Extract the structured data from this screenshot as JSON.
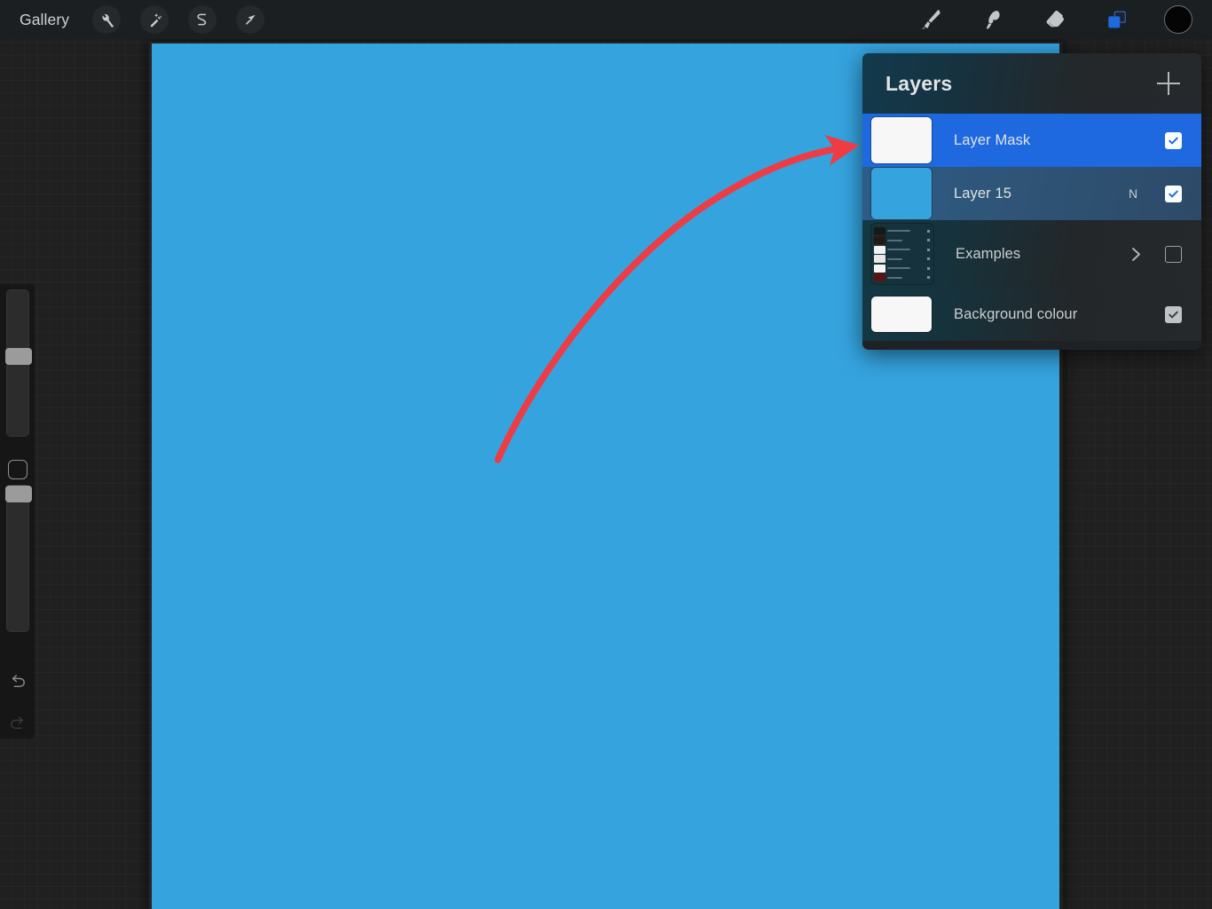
{
  "app": {
    "name": "Procreate",
    "canvas_color": "#35a3de",
    "accent_color": "#1f69e0",
    "annotation_color": "#ef3b44"
  },
  "topbar": {
    "gallery_label": "Gallery",
    "left_tools": [
      {
        "name": "actions-wrench-icon",
        "label": "Actions"
      },
      {
        "name": "adjustments-magic-icon",
        "label": "Adjustments"
      },
      {
        "name": "selection-icon",
        "label": "Selection"
      },
      {
        "name": "transform-arrow-icon",
        "label": "Transform"
      }
    ],
    "right_tools": [
      {
        "name": "paint-brush-icon",
        "label": "Paint"
      },
      {
        "name": "smudge-icon",
        "label": "Smudge"
      },
      {
        "name": "eraser-icon",
        "label": "Erase"
      },
      {
        "name": "layers-icon",
        "label": "Layers",
        "active": true
      }
    ],
    "color_swatch": {
      "name": "color-swatch",
      "label": "Colour",
      "value": "#050505"
    }
  },
  "sidebar": {
    "brush_size": {
      "label": "Brush size",
      "value_percent": 56
    },
    "modify_button": {
      "label": "Modify"
    },
    "opacity": {
      "label": "Opacity",
      "value_percent": 100
    },
    "undo": {
      "label": "Undo"
    },
    "redo": {
      "label": "Redo"
    }
  },
  "layers_panel": {
    "title": "Layers",
    "add_button_label": "Add layer",
    "rows": [
      {
        "name": "Layer Mask",
        "thumb": "white",
        "selected": "primary",
        "blend": "",
        "visible": true,
        "checkbox": "on",
        "chevron": false
      },
      {
        "name": "Layer 15",
        "thumb": "blue",
        "selected": "secondary",
        "blend": "N",
        "visible": true,
        "checkbox": "on",
        "chevron": false
      },
      {
        "name": "Examples",
        "thumb": "mini",
        "selected": "none",
        "blend": "",
        "visible": false,
        "checkbox": "off",
        "chevron": true
      },
      {
        "name": "Background colour",
        "thumb": "white",
        "selected": "none",
        "blend": "",
        "visible": true,
        "checkbox": "on-dim",
        "chevron": false
      }
    ]
  },
  "annotation": {
    "type": "curved-arrow",
    "points_to": "Layer Mask",
    "color": "#ef3b44"
  }
}
